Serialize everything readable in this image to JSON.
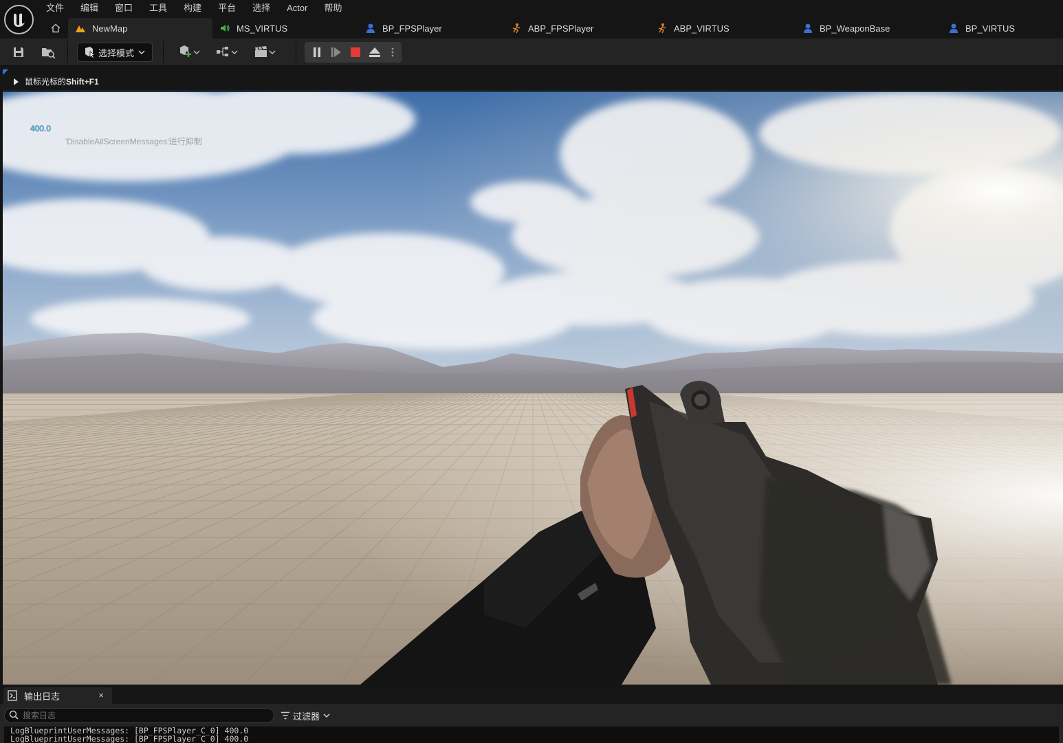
{
  "menu": {
    "items": [
      "文件",
      "编辑",
      "窗口",
      "工具",
      "构建",
      "平台",
      "选择",
      "Actor",
      "帮助"
    ]
  },
  "tabs": [
    {
      "label": "NewMap",
      "icon": "level-icon",
      "active": true
    },
    {
      "label": "MS_VIRTUS",
      "icon": "sound-icon",
      "active": false
    },
    {
      "label": "BP_FPSPlayer",
      "icon": "blueprint-pawn-icon",
      "active": false
    },
    {
      "label": "ABP_FPSPlayer",
      "icon": "anim-blueprint-icon",
      "active": false
    },
    {
      "label": "ABP_VIRTUS",
      "icon": "anim-blueprint-icon",
      "active": false
    },
    {
      "label": "BP_WeaponBase",
      "icon": "blueprint-pawn-icon",
      "active": false
    },
    {
      "label": "BP_VIRTUS",
      "icon": "blueprint-pawn-icon",
      "active": false
    }
  ],
  "toolbar": {
    "mode_label": "选择模式"
  },
  "viewport": {
    "hint_prefix": "鼠标光标的",
    "hint_shortcut": "Shift+F1",
    "screen_message": "400.0",
    "screen_note": "'DisableAllScreenMessages'进行抑制"
  },
  "log": {
    "tab_label": "输出日志",
    "close_glyph": "×",
    "search_placeholder": "搜索日志",
    "filter_label": "过滤器",
    "lines": [
      "LogBlueprintUserMessages: [BP_FPSPlayer_C_0] 400.0",
      "LogBlueprintUserMessages: [BP_FPSPlayer_C_0] 400.0"
    ]
  },
  "colors": {
    "accent_blue": "#2a7ae2",
    "stop_red": "#e53935",
    "level_orange": "#f0a020",
    "anim_orange": "#d9822b",
    "sound_green": "#4caf50",
    "blueprint_blue": "#3b6fd6",
    "screen_message": "#3fb7ff"
  }
}
